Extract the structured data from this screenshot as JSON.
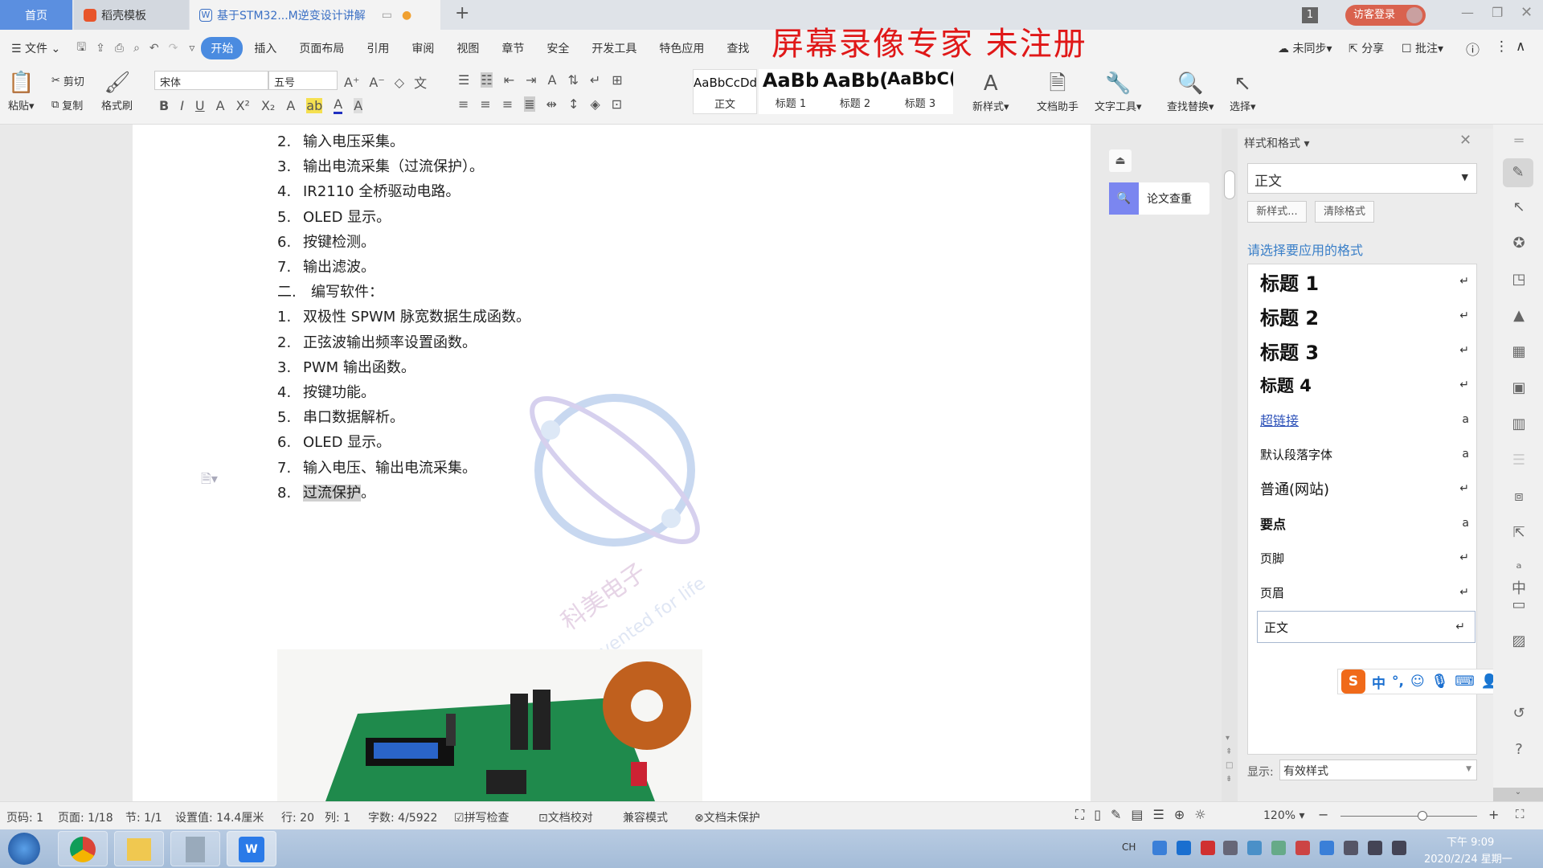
{
  "tabs": {
    "home": "首页",
    "daoke": "稻壳模板",
    "doc": "基于STM32...M逆变设计讲解",
    "add": "+"
  },
  "window": {
    "badge": "1",
    "login": "访客登录"
  },
  "menu": {
    "file": "文件",
    "items": [
      "开始",
      "插入",
      "页面布局",
      "引用",
      "审阅",
      "视图",
      "章节",
      "安全",
      "开发工具",
      "特色应用",
      "查找"
    ],
    "sync": "未同步",
    "share": "分享",
    "comment": "批注"
  },
  "watermark_red": "屏幕录像专家  未注册",
  "ribbon": {
    "paste": "粘贴",
    "cut": "剪切",
    "copy": "复制",
    "format_painter": "格式刷",
    "font": "宋体",
    "size": "五号",
    "styles": [
      {
        "preview": "AaBbCcDd",
        "label": "正文"
      },
      {
        "preview": "AaBb",
        "label": "标题 1"
      },
      {
        "preview": "AaBb(",
        "label": "标题 2"
      },
      {
        "preview": "AaBbC(",
        "label": "标题 3"
      }
    ],
    "new_style": "新样式",
    "doc_assistant": "文档助手",
    "text_tools": "文字工具",
    "find_replace": "查找替换",
    "select": "选择"
  },
  "document": {
    "lines": [
      {
        "num": "2.",
        "text": "输入电压采集。"
      },
      {
        "num": "3.",
        "text": "输出电流采集（过流保护）。"
      },
      {
        "num": "4.",
        "text": "IR2110 全桥驱动电路。"
      },
      {
        "num": "5.",
        "text": "OLED 显示。"
      },
      {
        "num": "6.",
        "text": "按键检测。"
      },
      {
        "num": "7.",
        "text": "输出滤波。"
      },
      {
        "num": "二.",
        "text": "编写软件："
      },
      {
        "num": "1.",
        "text": "双极性 SPWM 脉宽数据生成函数。"
      },
      {
        "num": "2.",
        "text": "正弦波输出频率设置函数。"
      },
      {
        "num": "3.",
        "text": "PWM 输出函数。"
      },
      {
        "num": "4.",
        "text": "按键功能。"
      },
      {
        "num": "5.",
        "text": "串口数据解析。"
      },
      {
        "num": "6.",
        "text": "OLED 显示。"
      },
      {
        "num": "7.",
        "text": "输入电压、输出电流采集。"
      },
      {
        "num": "8.",
        "text": "过流保护",
        "suffix": "。"
      }
    ],
    "watermark_cn": "科美电子",
    "watermark_en": "Invented for life"
  },
  "plagiarism": "论文查重",
  "style_panel": {
    "title": "样式和格式",
    "current": "正文",
    "new_style": "新样式...",
    "clear": "清除格式",
    "prompt": "请选择要应用的格式",
    "items": [
      {
        "label": "标题  1",
        "mark": "↵"
      },
      {
        "label": "标题  2",
        "mark": "↵"
      },
      {
        "label": "标题  3",
        "mark": "↵"
      },
      {
        "label": "标题  4",
        "mark": "↵"
      },
      {
        "label": "超链接",
        "mark": "a"
      },
      {
        "label": "默认段落字体",
        "mark": "a"
      },
      {
        "label": "普通(网站)",
        "mark": "↵"
      },
      {
        "label": "要点",
        "mark": "a"
      },
      {
        "label": "页脚",
        "mark": "↵"
      },
      {
        "label": "页眉",
        "mark": "↵"
      },
      {
        "label": "正文",
        "mark": "↵"
      }
    ],
    "show_label": "显示:",
    "show_value": "有效样式"
  },
  "ime": {
    "lang": "中",
    "punct": "°,"
  },
  "status": {
    "page_code": "页码: 1",
    "page": "页面: 1/18",
    "section": "节: 1/1",
    "setting": "设置值: 14.4厘米",
    "row": "行: 20",
    "col": "列: 1",
    "words": "字数: 4/5922",
    "spell": "拼写检查",
    "proof": "文档校对",
    "compat": "兼容模式",
    "protect": "文档未保护",
    "zoom": "120%",
    "zoom_level": 0.6
  },
  "taskbar": {
    "lang": "CH",
    "time": "下午 9:09",
    "date": "2020/2/24 星期一"
  },
  "colors": {
    "accent": "#4a8be0",
    "home_tab": "#5b8fe0",
    "watermark": "#e01818",
    "link": "#2a4fb8"
  }
}
